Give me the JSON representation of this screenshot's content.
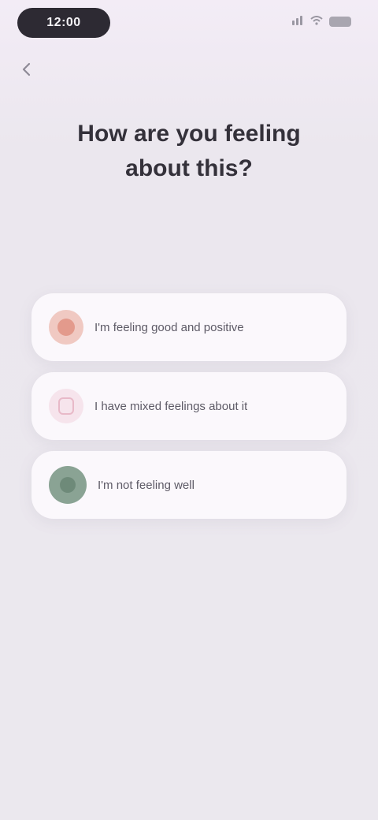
{
  "status_bar": {
    "time": "12:00"
  },
  "title": {
    "line1": "How are you feeling",
    "line2": "about this?"
  },
  "options": [
    {
      "label": "I'm feeling good and positive",
      "icon": "heart-icon",
      "color": "#e39a8c"
    },
    {
      "label": "I have mixed feelings about it",
      "icon": "note-icon",
      "color": "#e8b9c8"
    },
    {
      "label": "I'm not feeling well",
      "icon": "leaf-icon",
      "color": "#8aa394"
    }
  ]
}
